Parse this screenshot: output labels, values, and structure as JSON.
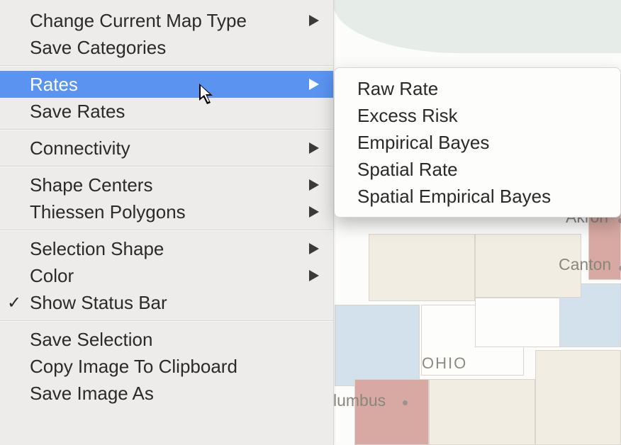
{
  "menu": {
    "items": [
      {
        "label": "Change Current Map Type",
        "submenu": true
      },
      {
        "label": "Save Categories"
      }
    ],
    "items2": [
      {
        "label": "Rates",
        "submenu": true,
        "highlighted": true
      },
      {
        "label": "Save Rates"
      }
    ],
    "items3": [
      {
        "label": "Connectivity",
        "submenu": true
      }
    ],
    "items4": [
      {
        "label": "Shape Centers",
        "submenu": true
      },
      {
        "label": "Thiessen Polygons",
        "submenu": true
      }
    ],
    "items5": [
      {
        "label": "Selection Shape",
        "submenu": true
      },
      {
        "label": "Color",
        "submenu": true
      },
      {
        "label": "Show Status Bar",
        "checked": true
      }
    ],
    "items6": [
      {
        "label": "Save Selection"
      },
      {
        "label": "Copy Image To Clipboard"
      },
      {
        "label": "Save Image As"
      }
    ]
  },
  "submenu": {
    "items": [
      {
        "label": "Raw Rate"
      },
      {
        "label": "Excess Risk"
      },
      {
        "label": "Empirical Bayes"
      },
      {
        "label": "Spatial Rate"
      },
      {
        "label": "Spatial Empirical Bayes"
      }
    ]
  },
  "map": {
    "state_label": "OHIO",
    "city_canton": "Canton",
    "city_akron": "Akron",
    "city_columbus": "lumbus"
  }
}
